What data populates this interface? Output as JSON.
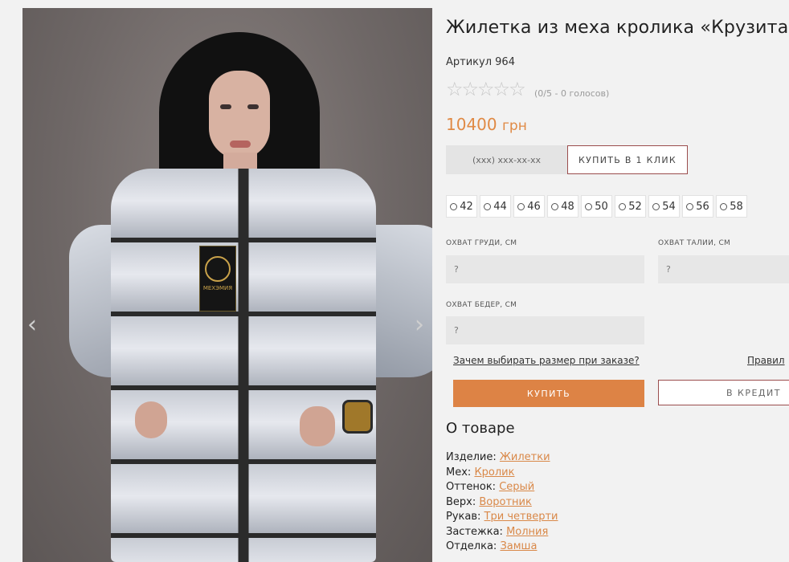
{
  "product": {
    "title": "Жилетка из меха кролика «Крузита»",
    "sku": "Артикул 964",
    "rating_text": "(0/5 - 0 голосов)",
    "rating_value": 0,
    "rating_max": 5,
    "price": "10400",
    "currency": "грн"
  },
  "photo": {
    "tag_text": "МЕХЭМИЯ",
    "prev_arrow": "‹",
    "next_arrow": "›"
  },
  "quick_buy": {
    "phone_placeholder": "(xxx) xxx-xx-xx",
    "one_click_label": "КУПИТЬ В 1 КЛИК"
  },
  "sizes": [
    "42",
    "44",
    "46",
    "48",
    "50",
    "52",
    "54",
    "56",
    "58"
  ],
  "measurements": {
    "chest_label": "ОХВАТ ГРУДИ, СМ",
    "chest_value": "?",
    "waist_label": "ОХВАТ ТАЛИИ, СМ",
    "waist_value": "?",
    "hips_label": "ОХВАТ БЕДЕР, СМ",
    "hips_value": "?"
  },
  "links": {
    "why_size": "Зачем выбирать размер при заказе?",
    "rules": "Правил"
  },
  "actions": {
    "buy_label": "КУПИТЬ",
    "credit_label": "В КРЕДИТ"
  },
  "about": {
    "heading": "О товаре",
    "attributes": [
      {
        "key": "Изделие:",
        "value": "Жилетки"
      },
      {
        "key": "Мех:",
        "value": "Кролик"
      },
      {
        "key": "Оттенок:",
        "value": "Серый"
      },
      {
        "key": "Верх:",
        "value": "Воротник"
      },
      {
        "key": "Рукав:",
        "value": "Три четверти"
      },
      {
        "key": "Застежка:",
        "value": "Молния"
      },
      {
        "key": "Отделка:",
        "value": "Замша"
      }
    ]
  },
  "colors": {
    "accent": "#dd8345",
    "price": "#e08a45",
    "border_accent": "#9b4d4d",
    "star_empty": "#c7c7c7"
  }
}
